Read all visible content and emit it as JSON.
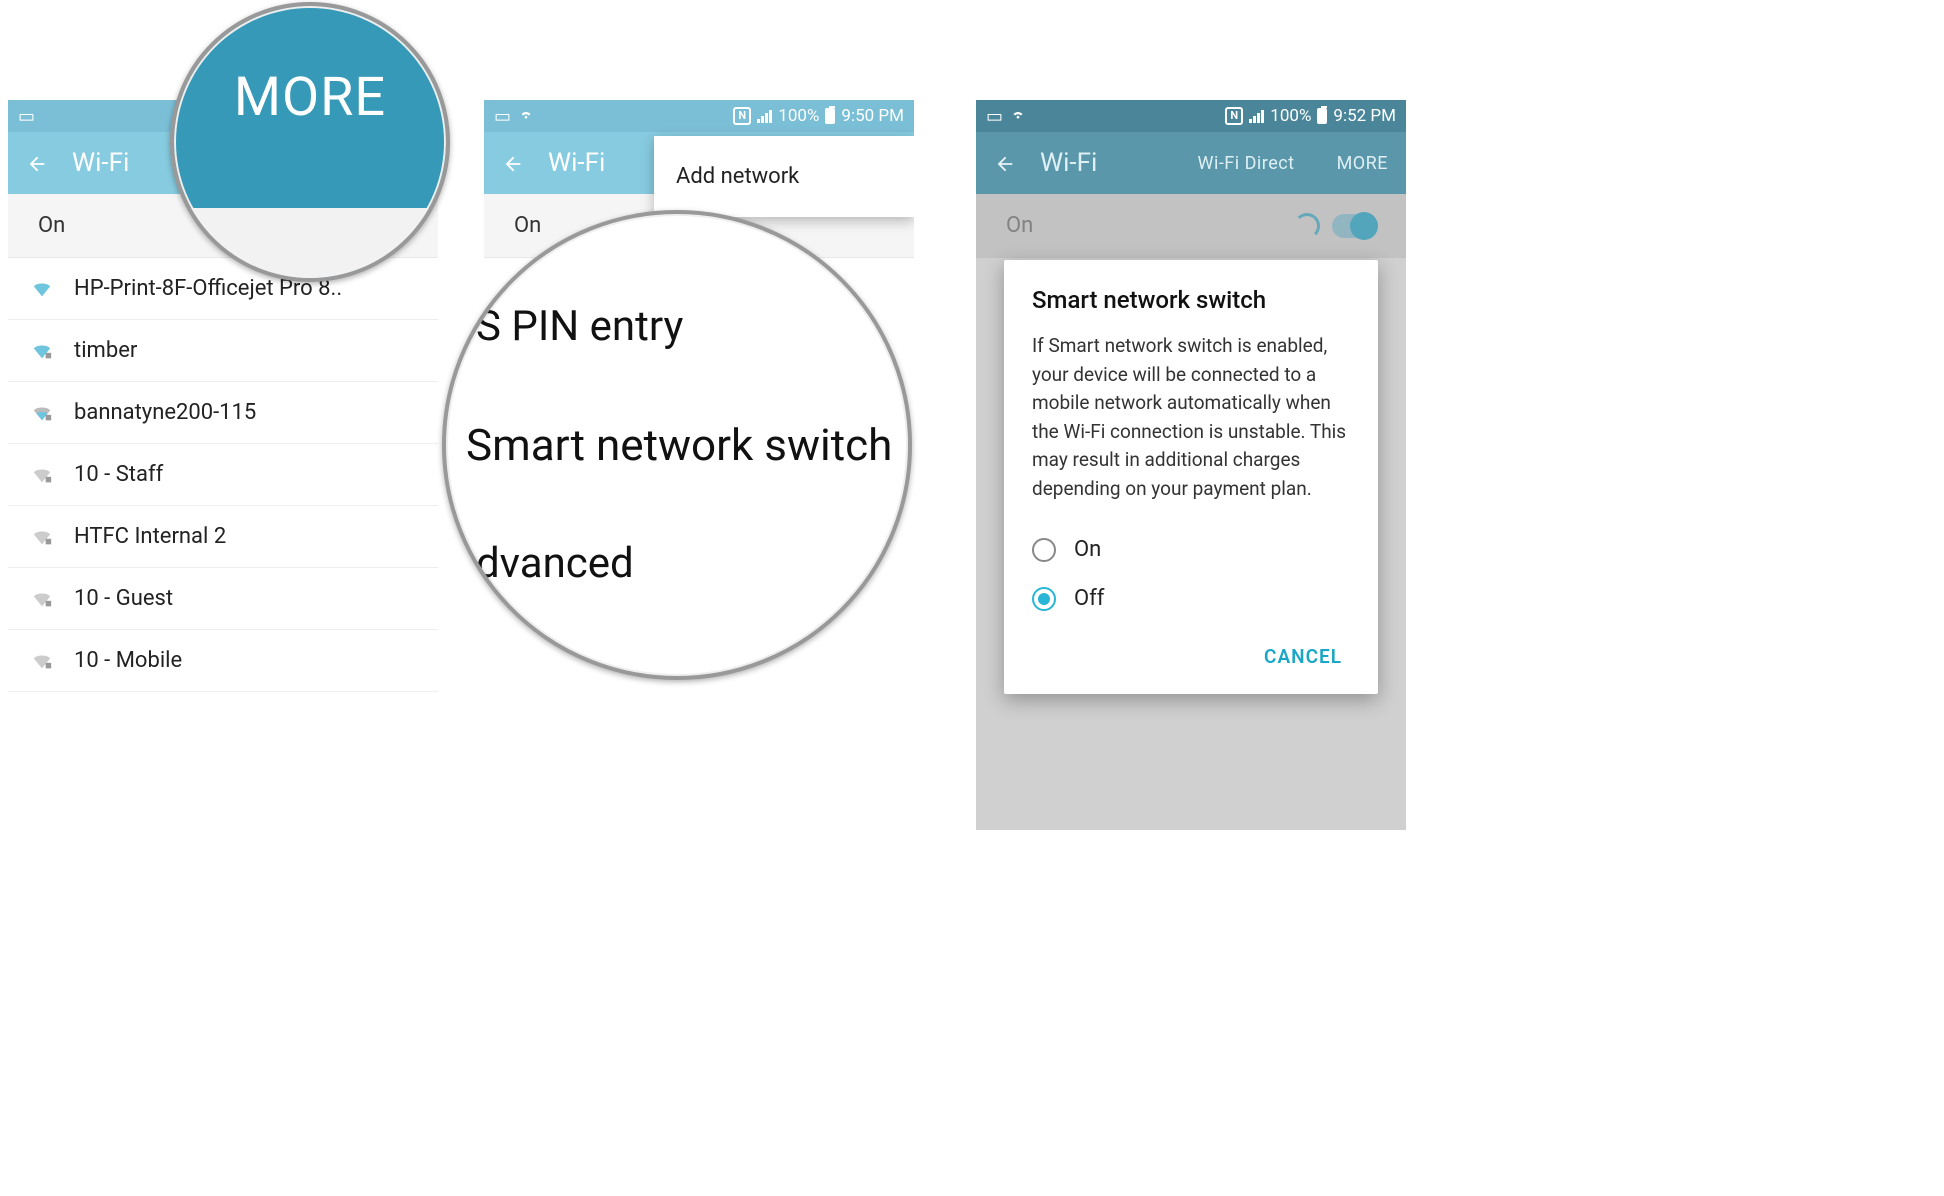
{
  "statusbar2": {
    "pct": "100%",
    "time": "9:50 PM",
    "nfc": "N"
  },
  "statusbar3": {
    "pct": "100%",
    "time": "9:52 PM",
    "nfc": "N"
  },
  "appbar": {
    "title": "Wi-Fi",
    "action_direct": "Wi-Fi Direct",
    "action_more": "MORE"
  },
  "on_label": "On",
  "networks": [
    "HP-Print-8F-Officejet Pro 8..",
    "timber",
    "bannatyne200-115",
    "10 - Staff",
    "HTFC Internal 2",
    "10 - Guest",
    "10 - Mobile"
  ],
  "dropdown": {
    "add_network": "Add network"
  },
  "magnifier1": {
    "text": "MORE"
  },
  "magnifier2": {
    "row1": "S PIN entry",
    "row2": "Smart network switch",
    "row3": "dvanced"
  },
  "dialog": {
    "title": "Smart network switch",
    "body": "If Smart network switch is enabled, your device will be connected to a mobile network automatically when the Wi-Fi connection is unstable. This may result in additional charges depending on your payment plan.",
    "opt_on": "On",
    "opt_off": "Off",
    "cancel": "CANCEL"
  }
}
